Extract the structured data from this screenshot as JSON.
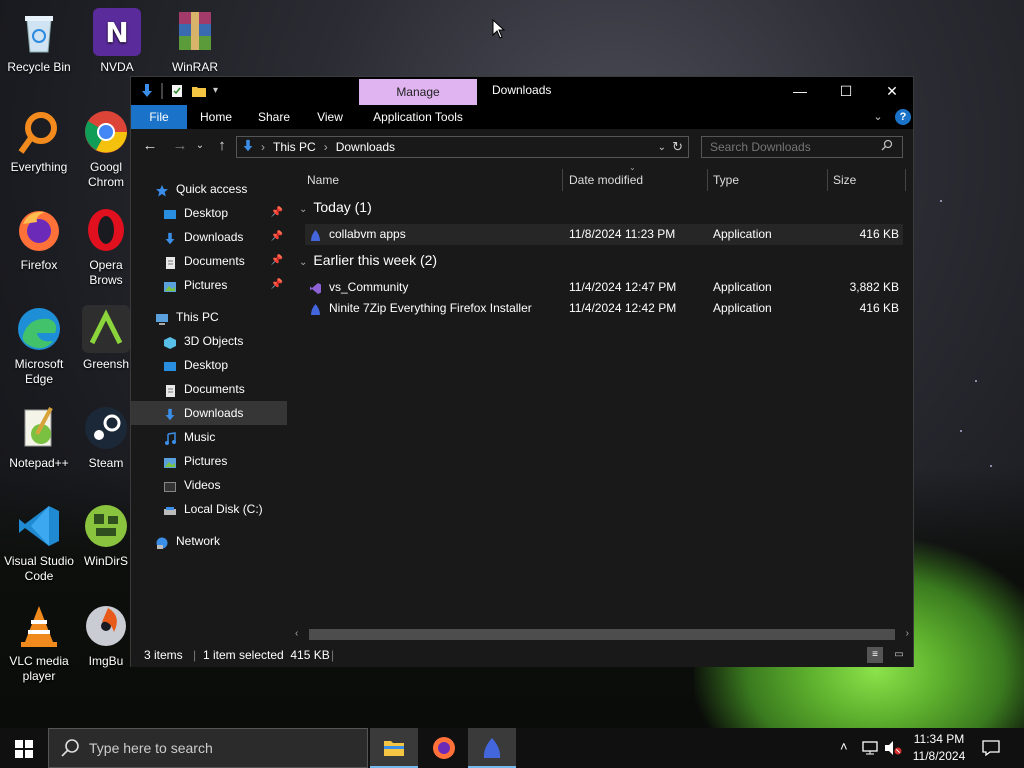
{
  "desktop": {
    "icons": [
      {
        "label": "Recycle Bin",
        "icon": "recycle-bin-icon"
      },
      {
        "label": "NVDA",
        "icon": "nvda-icon"
      },
      {
        "label": "WinRAR",
        "icon": "winrar-icon"
      },
      {
        "label": "Everything",
        "icon": "everything-icon"
      },
      {
        "label": "Googl\nChrom",
        "icon": "chrome-icon"
      },
      {
        "label": "Firefox",
        "icon": "firefox-icon"
      },
      {
        "label": "Opera\nBrows",
        "icon": "opera-icon"
      },
      {
        "label": "Microsoft\nEdge",
        "icon": "edge-icon"
      },
      {
        "label": "Greensh",
        "icon": "greenshot-icon"
      },
      {
        "label": "Notepad++",
        "icon": "notepadpp-icon"
      },
      {
        "label": "Steam",
        "icon": "steam-icon"
      },
      {
        "label": "Visual Studio\nCode",
        "icon": "vscode-icon"
      },
      {
        "label": "WinDirS",
        "icon": "windirstat-icon"
      },
      {
        "label": "VLC media\nplayer",
        "icon": "vlc-icon"
      },
      {
        "label": "ImgBu",
        "icon": "imgburn-icon"
      }
    ]
  },
  "window": {
    "title": "Downloads",
    "context_tab": "Manage",
    "ribbon_tabs": [
      "File",
      "Home",
      "Share",
      "View",
      "Application Tools"
    ],
    "minimize": "—",
    "maximize": "☐",
    "close": "✕",
    "help": "?"
  },
  "address": {
    "crumbs": [
      "This PC",
      "Downloads"
    ],
    "search_placeholder": "Search Downloads"
  },
  "nav": {
    "quick_access": "Quick access",
    "quick_items": [
      "Desktop",
      "Downloads",
      "Documents",
      "Pictures"
    ],
    "this_pc": "This PC",
    "pc_items": [
      "3D Objects",
      "Desktop",
      "Documents",
      "Downloads",
      "Music",
      "Pictures",
      "Videos",
      "Local Disk (C:)"
    ],
    "network": "Network",
    "selected": "Downloads"
  },
  "columns": {
    "name": "Name",
    "date": "Date modified",
    "type": "Type",
    "size": "Size"
  },
  "groups": [
    {
      "label": "Today (1)",
      "files": [
        {
          "name": "collabvm apps",
          "date": "11/8/2024 11:23 PM",
          "type": "Application",
          "size": "416 KB",
          "icon": "collabvm-app-icon",
          "selected": true
        }
      ]
    },
    {
      "label": "Earlier this week (2)",
      "files": [
        {
          "name": "vs_Community",
          "date": "11/4/2024 12:47 PM",
          "type": "Application",
          "size": "3,882 KB",
          "icon": "visual-studio-installer-icon",
          "selected": false
        },
        {
          "name": "Ninite 7Zip Everything Firefox Installer",
          "date": "11/4/2024 12:42 PM",
          "type": "Application",
          "size": "416 KB",
          "icon": "ninite-icon",
          "selected": false
        }
      ]
    }
  ],
  "status": {
    "items": "3 items",
    "selection": "1 item selected  415 KB"
  },
  "taskbar": {
    "search_placeholder": "Type here to search",
    "time": "11:34 PM",
    "date": "11/8/2024"
  },
  "colors": {
    "accent": "#1a73c9",
    "manage_tab": "#dfb4f0",
    "window_bg": "#191919"
  }
}
